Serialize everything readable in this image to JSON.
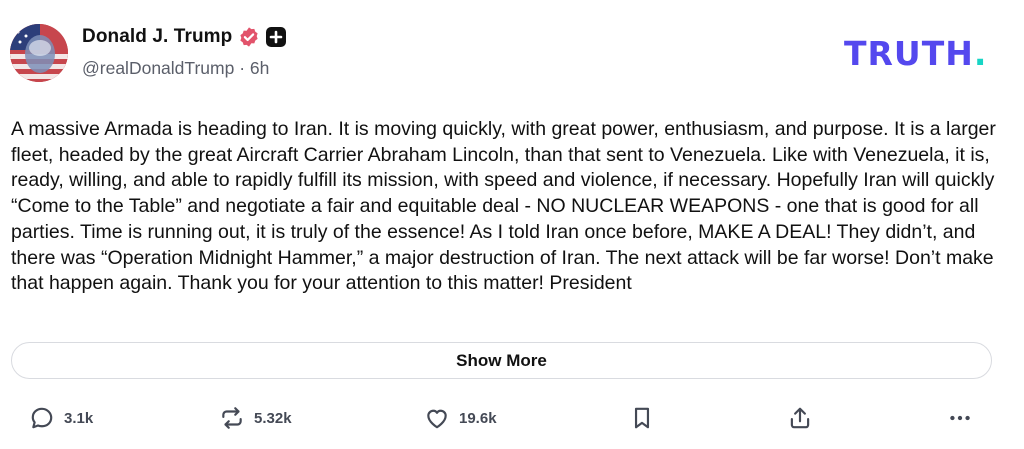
{
  "author": {
    "display_name": "Donald J. Trump",
    "handle": "@realDonaldTrump",
    "separator": "·",
    "time_ago": "6h"
  },
  "brand": {
    "logo_text": "TRUTH",
    "logo_dot": ".",
    "accent_color": "#5448ee",
    "dot_color": "#17d5c5",
    "verified_color": "#e2536b"
  },
  "post": {
    "text": "A massive Armada is heading to Iran. It is moving quickly, with great power, enthusiasm, and purpose. It is a larger fleet, headed by the great Aircraft Carrier Abraham Lincoln, than that sent to Venezuela. Like with Venezuela, it is, ready, willing, and able to rapidly fulfill its mission, with speed and violence, if necessary. Hopefully Iran will quickly “Come to the Table” and negotiate a fair and equitable deal - NO NUCLEAR WEAPONS - one that is good for all parties. Time is running out, it is truly of the essence! As I told Iran once before, MAKE A DEAL! They didn’t, and there was “Operation Midnight Hammer,” a major destruction of Iran. The next attack will be far worse! Don’t make that happen again. Thank you for your attention to this matter! President",
    "show_more_label": "Show More"
  },
  "actions": {
    "replies": "3.1k",
    "retruths": "5.32k",
    "likes": "19.6k"
  },
  "icons": {
    "reply": "speech-bubble-icon",
    "retruth": "repost-arrows-icon",
    "like": "heart-icon",
    "bookmark": "bookmark-icon",
    "share": "share-upload-icon",
    "more": "ellipsis-icon",
    "verified": "verified-badge-icon",
    "plus": "plus-badge-icon"
  }
}
